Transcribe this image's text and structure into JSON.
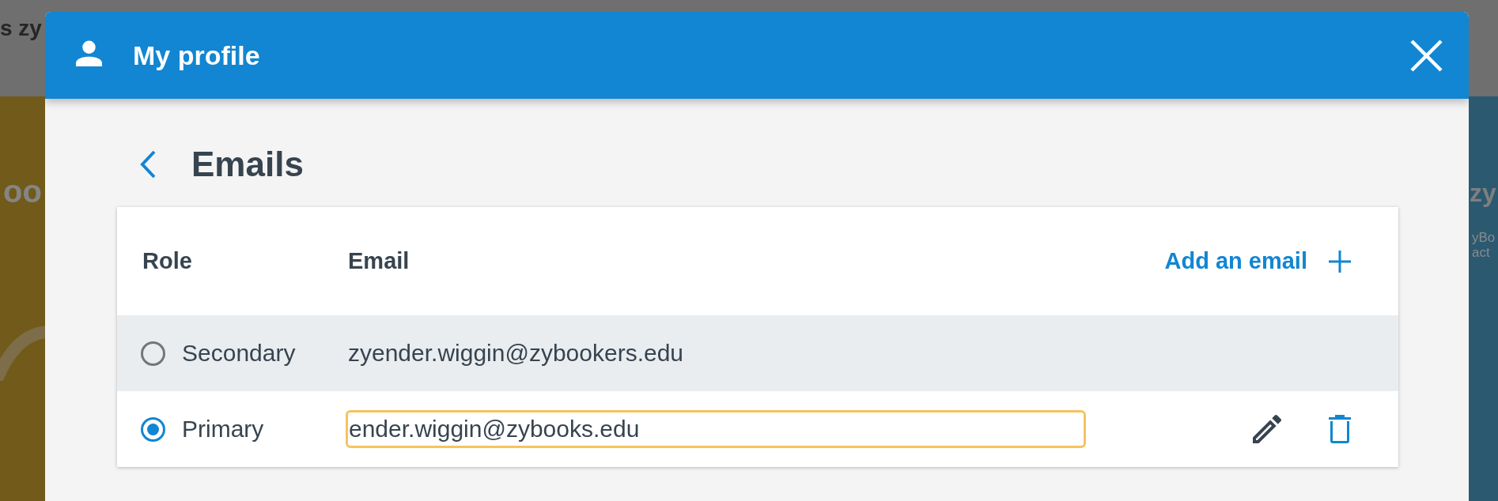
{
  "background": {
    "header_text": "s zy",
    "left_panel_text": "oo",
    "right_panel_title": "zy",
    "right_panel_lines": [
      "yBo",
      "act"
    ]
  },
  "dialog": {
    "title": "My profile"
  },
  "page": {
    "title": "Emails"
  },
  "table": {
    "columns": [
      "Role",
      "Email"
    ],
    "add_action": "Add an email",
    "rows": [
      {
        "role": "Secondary",
        "email": "zyender.wiggin@zybookers.edu",
        "selected": false,
        "hovered": true,
        "editing": false
      },
      {
        "role": "Primary",
        "email": "ender.wiggin@zybooks.edu",
        "selected": true,
        "hovered": false,
        "editing": true
      }
    ]
  }
}
